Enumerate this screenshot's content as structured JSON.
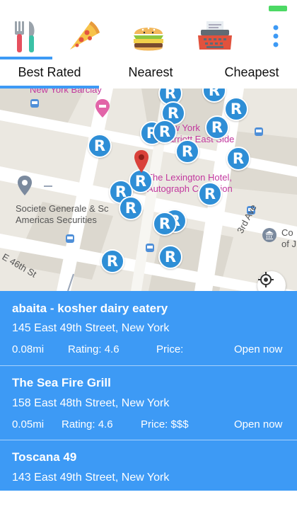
{
  "colors": {
    "accent": "#3d9af5",
    "marker": "#2e8ed6",
    "battery": "#4cd964",
    "selected_pin": "#d9413a"
  },
  "status_bar": {
    "battery_icon": "battery-full-icon"
  },
  "categories": [
    {
      "id": "all",
      "icon": "fork-knife-icon",
      "selected": true
    },
    {
      "id": "pizza",
      "icon": "pizza-slice-icon",
      "selected": false
    },
    {
      "id": "burger",
      "icon": "burger-icon",
      "selected": false
    },
    {
      "id": "office",
      "icon": "typewriter-icon",
      "selected": false
    },
    {
      "id": "more",
      "icon": "more-vertical-icon",
      "selected": false
    }
  ],
  "tabs": {
    "best_rated": "Best Rated",
    "nearest": "Nearest",
    "cheapest": "Cheapest",
    "selected": "Best Rated"
  },
  "map": {
    "marker_letter": "R",
    "labels": {
      "barclay": "New York Barclay",
      "marriott": "New York\nMarriott East Side",
      "lexington": "The Lexington Hotel,\nAutograph Collection",
      "societe": "Societe Generale & Sc\nAmericas Securities",
      "e46": "E 46th St",
      "third_ave": "3rd Ave",
      "cor": "Co\nof J"
    }
  },
  "restaurants": [
    {
      "name": "abaita - kosher dairy eatery",
      "address": "145 East 49th Street, New York",
      "distance": "0.08mi",
      "rating": "Rating: 4.6",
      "price": "Price:",
      "status": "Open now"
    },
    {
      "name": "The Sea Fire Grill",
      "address": "158 East 48th Street, New York",
      "distance": "0.05mi",
      "rating": "Rating: 4.6",
      "price": "Price: $$$",
      "status": "Open now"
    },
    {
      "name": "Toscana 49",
      "address": "143 East 49th Street, New York"
    }
  ]
}
